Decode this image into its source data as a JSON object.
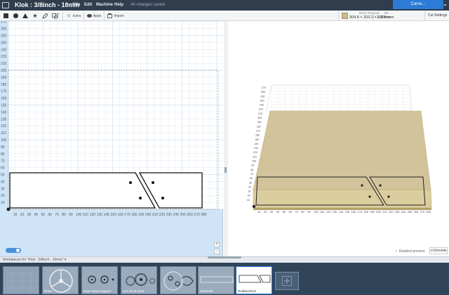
{
  "header": {
    "title": "Klok : 3/8inch - 10mm",
    "menus": [
      "File",
      "Edit",
      "Machine",
      "Help"
    ],
    "status": "All changes saved",
    "carve_label": "Carve..."
  },
  "toolbar": {
    "icons_label": "Icons",
    "apps_label": "Apps",
    "import_label": "Import",
    "material_label": "Birch Plywood",
    "material_dims": "304.8 × 203.2 × 9.6 mm",
    "bit_label": "Bit",
    "bit_size": "1.500 mm",
    "cut_settings_label": "Cut Settings"
  },
  "canvas2d": {
    "y_ticks": [
      "270",
      "260",
      "250",
      "240",
      "230",
      "220",
      "210",
      "200",
      "190",
      "180",
      "170",
      "160",
      "150",
      "140",
      "130",
      "120",
      "110",
      "100",
      "90",
      "80",
      "70",
      "60",
      "50",
      "40",
      "30",
      "20",
      "10"
    ],
    "x_ticks": [
      "10",
      "20",
      "30",
      "40",
      "50",
      "60",
      "70",
      "80",
      "90",
      "100",
      "110",
      "120",
      "130",
      "140",
      "150",
      "160",
      "170",
      "180",
      "190",
      "200",
      "210",
      "220",
      "230",
      "240",
      "250",
      "260",
      "270",
      "280"
    ]
  },
  "preview3d": {
    "y_ticks": [
      "270",
      "260",
      "250",
      "240",
      "230",
      "220",
      "210",
      "200",
      "190",
      "180",
      "170",
      "160",
      "150",
      "140",
      "130",
      "120",
      "110",
      "100",
      "90",
      "80",
      "70",
      "60",
      "50",
      "40",
      "30",
      "20",
      "10"
    ],
    "x_ticks": [
      "10",
      "20",
      "30",
      "40",
      "50",
      "60",
      "70",
      "80",
      "90",
      "100",
      "110",
      "120",
      "130",
      "140",
      "150",
      "160",
      "170",
      "180",
      "190",
      "200",
      "210",
      "220",
      "230",
      "240",
      "250",
      "260",
      "270",
      "280"
    ],
    "detailed_preview_label": "Detailed preview",
    "simulate_label": "Simulate"
  },
  "workpieces": {
    "header": "Workpieces for \"Klok : 3/8inch - 10mm\"",
    "items": [
      {
        "name": ""
      },
      {
        "name": "Drive..."
      },
      {
        "name": "Gear wheel support"
      },
      {
        "name": "x10 10 x8 Gear"
      },
      {
        "name": ""
      },
      {
        "name": "RailTeeth"
      },
      {
        "name": "RailBackEnd"
      }
    ]
  },
  "colors": {
    "topbar": "#2f3d4d",
    "accent": "#2c7bd6",
    "canvas_bg": "#cfe5f7",
    "plywood": "#d2c39a"
  }
}
